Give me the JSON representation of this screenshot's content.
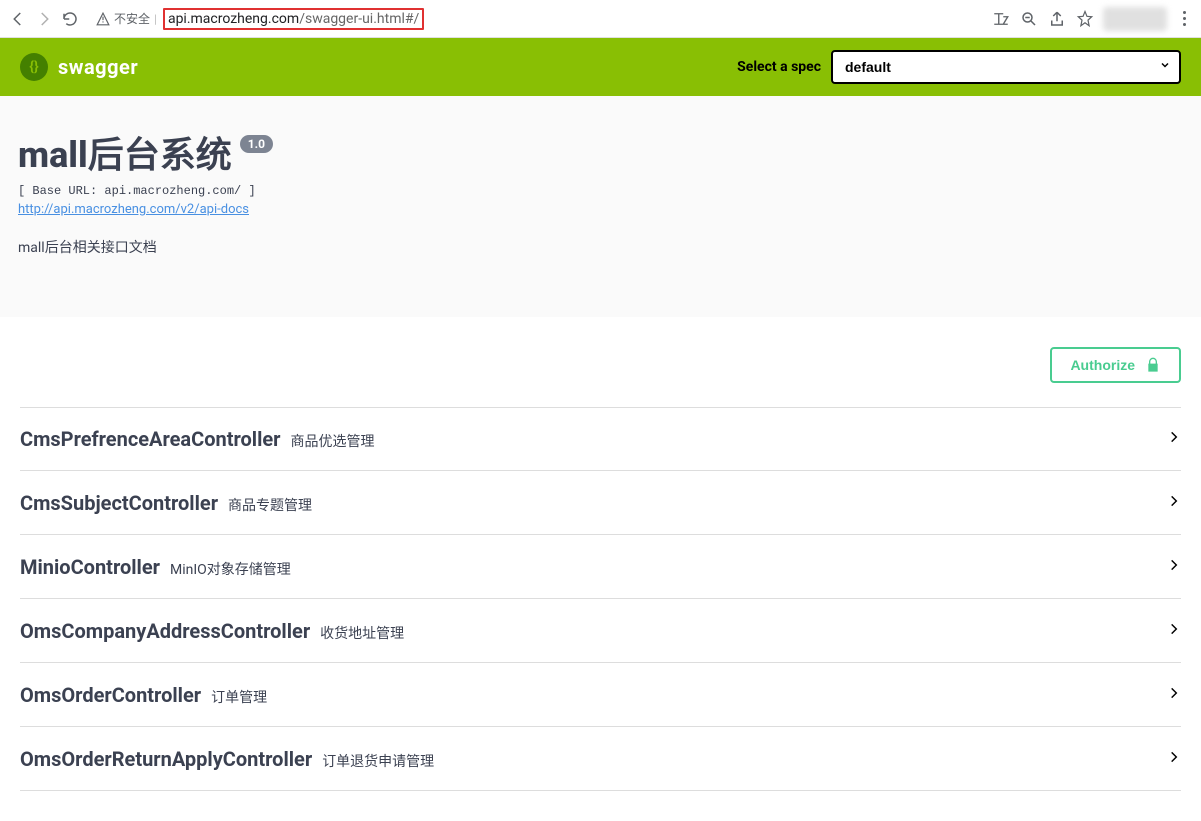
{
  "browser": {
    "insecure_label": "不安全",
    "url_plain": "api.macrozheng.com",
    "url_path": "/swagger-ui.html#/"
  },
  "topbar": {
    "brand": "swagger",
    "select_label": "Select a spec",
    "selected_spec": "default"
  },
  "info": {
    "title": "mall后台系统",
    "version": "1.0",
    "base_url": "[ Base URL: api.macrozheng.com/ ]",
    "docs_url": "http://api.macrozheng.com/v2/api-docs",
    "description": "mall后台相关接口文档"
  },
  "auth": {
    "button_label": "Authorize"
  },
  "operations": [
    {
      "name": "CmsPrefrenceAreaController",
      "desc": "商品优选管理"
    },
    {
      "name": "CmsSubjectController",
      "desc": "商品专题管理"
    },
    {
      "name": "MinioController",
      "desc": "MinIO对象存储管理"
    },
    {
      "name": "OmsCompanyAddressController",
      "desc": "收货地址管理"
    },
    {
      "name": "OmsOrderController",
      "desc": "订单管理"
    },
    {
      "name": "OmsOrderReturnApplyController",
      "desc": "订单退货申请管理"
    }
  ]
}
